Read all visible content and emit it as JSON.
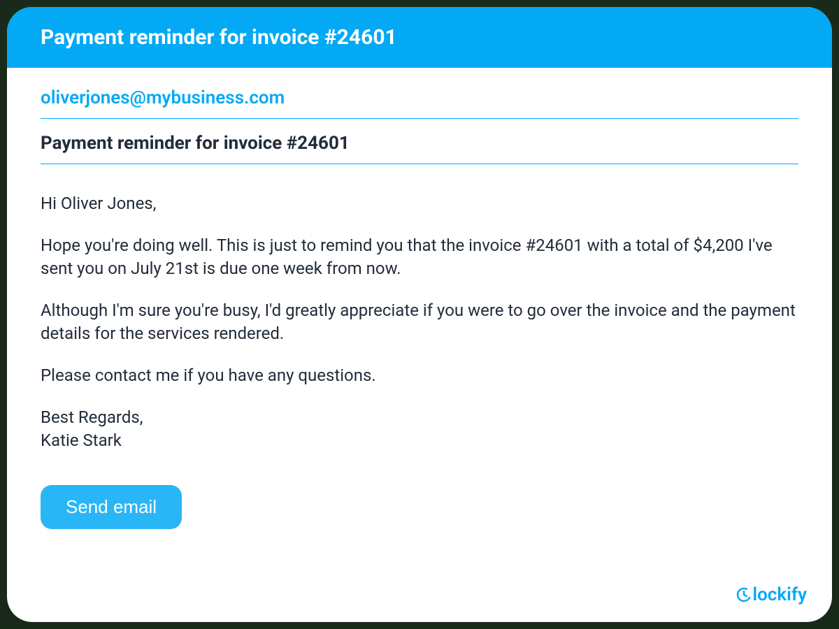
{
  "header": {
    "title": "Payment reminder for invoice #24601"
  },
  "email": {
    "recipient": "oliverjones@mybusiness.com",
    "subject": "Payment reminder for invoice #24601",
    "greeting": "Hi Oliver Jones,",
    "paragraph1": "Hope you're doing well. This is just to remind you that the invoice #24601 with a total of $4,200 I've sent you on July 21st is due one week from now.",
    "paragraph2": "Although I'm sure you're busy, I'd greatly appreciate if you were to go over the invoice and the payment details for the services rendered.",
    "paragraph3": "Please contact me if you have any questions.",
    "signoff": "Best Regards,",
    "sender": "Katie Stark"
  },
  "actions": {
    "send_label": "Send email"
  },
  "brand": {
    "name": "lockify"
  }
}
